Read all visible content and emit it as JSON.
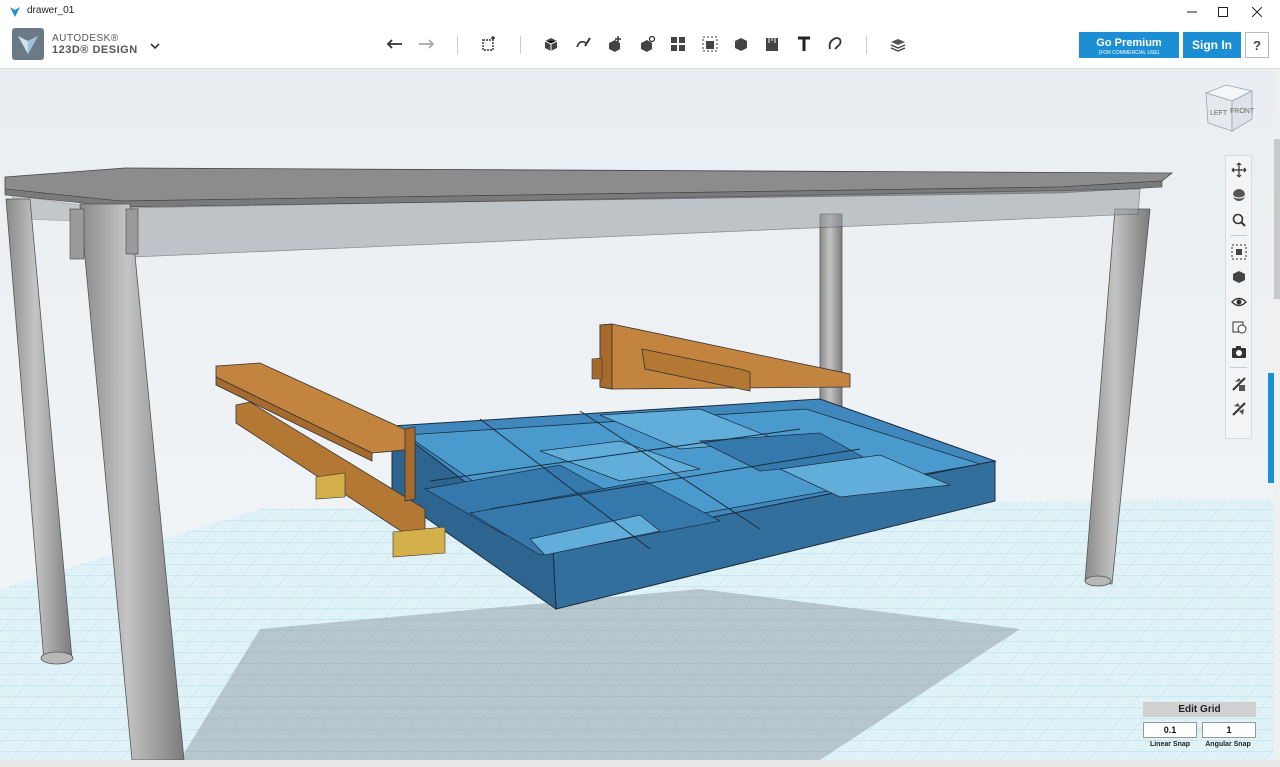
{
  "window": {
    "title": "drawer_01"
  },
  "brand": {
    "line1": "AUTODESK®",
    "line2": "123D® DESIGN"
  },
  "toolbar": {
    "tools": [
      "undo-icon",
      "redo-icon",
      "transform-icon",
      "primitives-icon",
      "sketch-icon",
      "construct-icon",
      "modify-icon",
      "pattern-icon",
      "group-icon",
      "combine-icon",
      "measure-icon",
      "text-icon",
      "snap-icon",
      "material-icon"
    ]
  },
  "header": {
    "premium_label": "Go Premium",
    "premium_sub": "(FOR COMMERCIAL USE)",
    "signin_label": "Sign In",
    "help_label": "?"
  },
  "viewcube": {
    "left": "LEFT",
    "front": "FRONT"
  },
  "nav_tools": [
    "pan-icon",
    "orbit-icon",
    "zoom-icon",
    "fit-icon",
    "view-icon",
    "visibility-icon",
    "materials-view-icon",
    "screenshot-icon",
    "snap-tool-icon",
    "hide-icon"
  ],
  "grid": {
    "edit_label": "Edit Grid",
    "linear_value": "0.1",
    "angular_value": "1",
    "linear_label": "Linear Snap",
    "angular_label": "Angular Snap"
  },
  "colors": {
    "accent": "#1b8ed4",
    "tray": "#3a7fb4",
    "wood": "#c08040",
    "table": "#9a9a9a",
    "grid": "#d6eef6"
  }
}
